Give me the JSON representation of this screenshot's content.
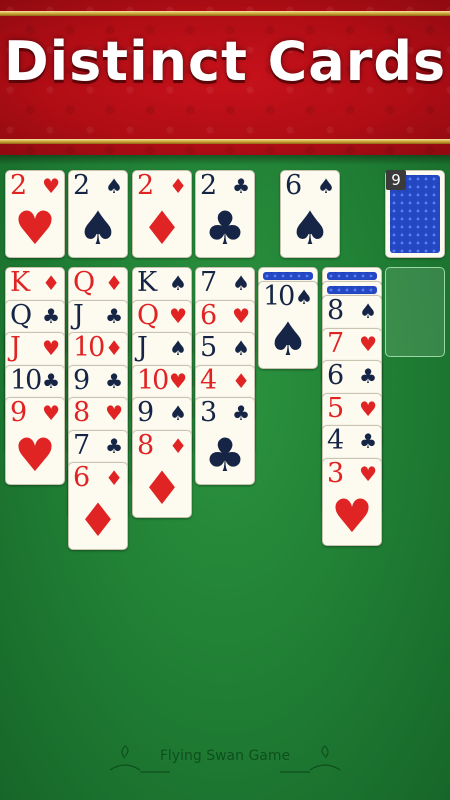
{
  "banner": {
    "title": "Distinct Cards"
  },
  "foundations": [
    {
      "rank": "2",
      "suit": "♥",
      "color": "red"
    },
    {
      "rank": "2",
      "suit": "♠",
      "color": "black"
    },
    {
      "rank": "2",
      "suit": "♦",
      "color": "red"
    },
    {
      "rank": "2",
      "suit": "♣",
      "color": "black"
    }
  ],
  "waste_card": {
    "rank": "6",
    "suit": "♠",
    "color": "black"
  },
  "stock": {
    "count": "9",
    "icon": "card-back-icon"
  },
  "tableau": [
    {
      "hidden": 0,
      "cards": [
        {
          "rank": "K",
          "suit": "♦",
          "color": "red"
        },
        {
          "rank": "Q",
          "suit": "♣",
          "color": "black"
        },
        {
          "rank": "J",
          "suit": "♥",
          "color": "red"
        },
        {
          "rank": "10",
          "suit": "♣",
          "color": "black"
        },
        {
          "rank": "9",
          "suit": "♥",
          "color": "red"
        }
      ]
    },
    {
      "hidden": 0,
      "cards": [
        {
          "rank": "Q",
          "suit": "♦",
          "color": "red"
        },
        {
          "rank": "J",
          "suit": "♣",
          "color": "black"
        },
        {
          "rank": "10",
          "suit": "♦",
          "color": "red"
        },
        {
          "rank": "9",
          "suit": "♣",
          "color": "black"
        },
        {
          "rank": "8",
          "suit": "♥",
          "color": "red"
        },
        {
          "rank": "7",
          "suit": "♣",
          "color": "black"
        },
        {
          "rank": "6",
          "suit": "♦",
          "color": "red"
        }
      ]
    },
    {
      "hidden": 0,
      "cards": [
        {
          "rank": "K",
          "suit": "♠",
          "color": "black"
        },
        {
          "rank": "Q",
          "suit": "♥",
          "color": "red"
        },
        {
          "rank": "J",
          "suit": "♠",
          "color": "black"
        },
        {
          "rank": "10",
          "suit": "♥",
          "color": "red"
        },
        {
          "rank": "9",
          "suit": "♠",
          "color": "black"
        },
        {
          "rank": "8",
          "suit": "♦",
          "color": "red"
        }
      ]
    },
    {
      "hidden": 0,
      "cards": [
        {
          "rank": "7",
          "suit": "♠",
          "color": "black"
        },
        {
          "rank": "6",
          "suit": "♥",
          "color": "red"
        },
        {
          "rank": "5",
          "suit": "♠",
          "color": "black"
        },
        {
          "rank": "4",
          "suit": "♦",
          "color": "red"
        },
        {
          "rank": "3",
          "suit": "♣",
          "color": "black"
        }
      ]
    },
    {
      "hidden": 1,
      "cards": [
        {
          "rank": "10",
          "suit": "♠",
          "color": "black"
        }
      ]
    },
    {
      "hidden": 2,
      "cards": [
        {
          "rank": "8",
          "suit": "♠",
          "color": "black"
        },
        {
          "rank": "7",
          "suit": "♥",
          "color": "red"
        },
        {
          "rank": "6",
          "suit": "♣",
          "color": "black"
        },
        {
          "rank": "5",
          "suit": "♥",
          "color": "red"
        },
        {
          "rank": "4",
          "suit": "♣",
          "color": "black"
        },
        {
          "rank": "3",
          "suit": "♥",
          "color": "red"
        }
      ]
    }
  ],
  "footer": {
    "text": "Flying Swan Game",
    "icon": "swan-icon"
  },
  "colors": {
    "red": "#e02424",
    "black": "#162545",
    "felt": "#1f7d33",
    "banner": "#b00d15",
    "card_back": "#2447c4"
  }
}
